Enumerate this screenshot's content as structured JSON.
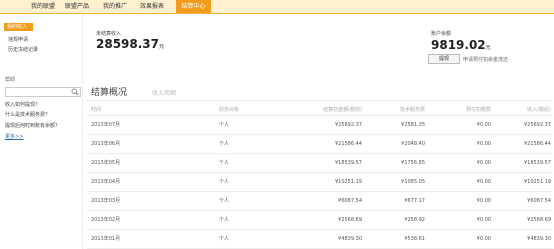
{
  "topnav": {
    "tabs": [
      {
        "label": "我的联盟"
      },
      {
        "label": "联盟产品"
      },
      {
        "label": "我的推广"
      },
      {
        "label": "效果报表"
      },
      {
        "label": "结算中心"
      }
    ]
  },
  "sidebar": {
    "items": [
      {
        "label": "我的收入"
      },
      {
        "label": "违规申请"
      },
      {
        "label": "历史冻结记录"
      }
    ],
    "help": {
      "title": "帮助",
      "search_placeholder": "",
      "links": [
        {
          "label": "收入如何提现？"
        },
        {
          "label": "什么是技术服务费？"
        },
        {
          "label": "提现后何时到账有余额？"
        },
        {
          "label": "更多>>"
        }
      ]
    }
  },
  "summary": {
    "unsettled_label": "未结算收入",
    "unsettled_value": "28598.37",
    "unsettled_unit": "元",
    "balance_label": "账户余额",
    "balance_value": "9819.02",
    "balance_unit": "元",
    "withdraw_button": "提现",
    "withdraw_note": "申请预付扣余金流还"
  },
  "section": {
    "title": "结算概况",
    "tab": "收入明细"
  },
  "table": {
    "headers": [
      "时间",
      "财务对象",
      "结算前金额(税前)",
      "技术服务费",
      "预付扣税款",
      "收入(税后)"
    ],
    "rows": [
      [
        "2013年07月",
        "个人",
        "¥25692.37",
        "¥2581.35",
        "¥0.00",
        "¥25692.37"
      ],
      [
        "2013年06月",
        "个人",
        "¥21586.44",
        "¥2048.40",
        "¥0.00",
        "¥21586.44"
      ],
      [
        "2013年05月",
        "个人",
        "¥18539.57",
        "¥1756.85",
        "¥0.00",
        "¥18539.57"
      ],
      [
        "2013年04月",
        "个人",
        "¥10251.19",
        "¥1085.05",
        "¥0.00",
        "¥10251.19"
      ],
      [
        "2013年03月",
        "个人",
        "¥6087.54",
        "¥677.17",
        "¥0.00",
        "¥6087.54"
      ],
      [
        "2013年02月",
        "个人",
        "¥2568.69",
        "¥258.92",
        "¥0.00",
        "¥2568.69"
      ],
      [
        "2013年01月",
        "个人",
        "¥4839.30",
        "¥538.61",
        "¥0.00",
        "¥4839.30"
      ]
    ]
  },
  "colors": {
    "accent": "#f39b1a",
    "nav_bg": "#fdf1cf"
  }
}
